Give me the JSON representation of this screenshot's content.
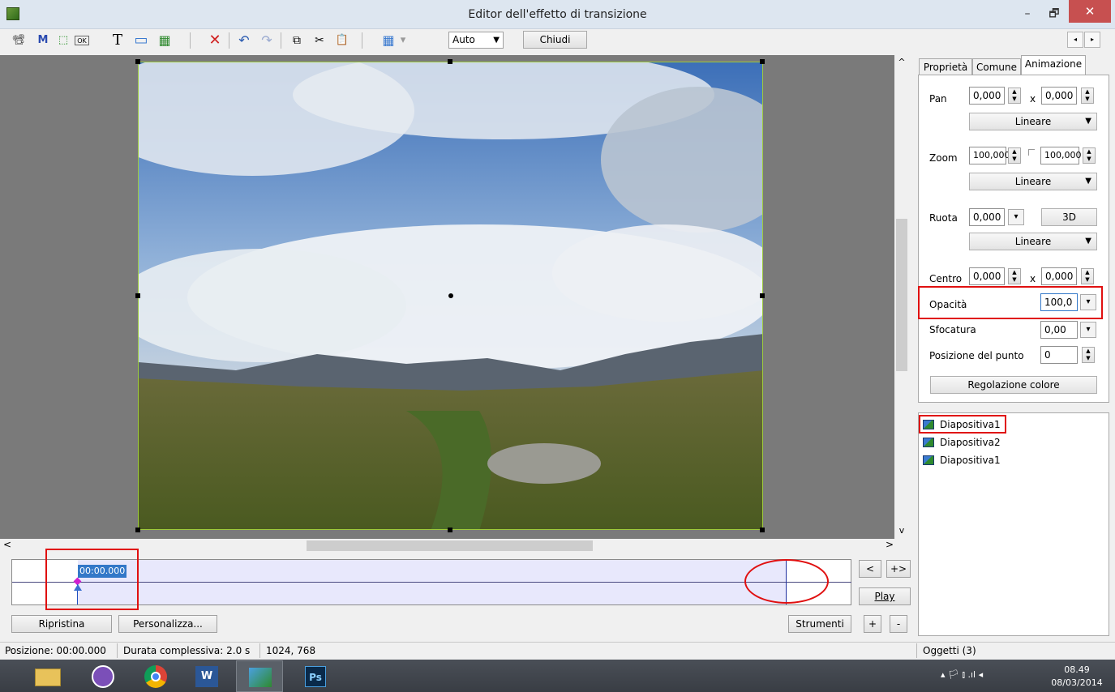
{
  "window": {
    "title": "Editor dell'effetto di transizione",
    "minimize": "–",
    "maximize": "🗗",
    "close": "✕"
  },
  "toolbar": {
    "auto_label": "Auto",
    "close_label": "Chiudi",
    "icons": {
      "camera": "📽",
      "mask": "M",
      "frame": "⬚",
      "button": "OK",
      "text": "T",
      "rect": "▭",
      "image": "▦",
      "delete": "✕",
      "undo": "↶",
      "redo": "↷",
      "copy": "⧉",
      "cut": "✂",
      "paste": "📋",
      "grid": "▦",
      "grid_arrow": "▾"
    },
    "nav_left": "◂",
    "nav_right": "▸"
  },
  "scroll": {
    "up": "^",
    "down": "v",
    "left": "<",
    "right": ">"
  },
  "timeline": {
    "time": "00:00.000"
  },
  "controls": {
    "ripristina": "Ripristina",
    "personalizza": "Personalizza...",
    "strumenti": "Strumenti",
    "prev": "<",
    "next": "+>",
    "play": "Play",
    "plus": "+",
    "minus": "-"
  },
  "panel": {
    "tabs": [
      "Proprietà",
      "Comune",
      "Animazione"
    ],
    "pan": {
      "label": "Pan",
      "x": "0,000",
      "sep": "x",
      "y": "0,000",
      "curve": "Lineare"
    },
    "zoom": {
      "label": "Zoom",
      "x": "100,000",
      "y": "100,000",
      "curve": "Lineare"
    },
    "rotate": {
      "label": "Ruota",
      "value": "0,000",
      "btn3d": "3D",
      "curve": "Lineare"
    },
    "center": {
      "label": "Centro",
      "x": "0,000",
      "sep": "x",
      "y": "0,000"
    },
    "opacity": {
      "label": "Opacità",
      "value": "100,0"
    },
    "blur": {
      "label": "Sfocatura",
      "value": "0,00"
    },
    "point_pos": {
      "label": "Posizione del punto",
      "value": "0"
    },
    "color_btn": "Regolazione colore"
  },
  "objects": [
    "Diapositiva1",
    "Diapositiva2",
    "Diapositiva1"
  ],
  "status": {
    "position": "Posizione: 00:00.000",
    "duration": "Durata complessiva: 2.0 s",
    "resolution": "1024, 768",
    "objects": "Oggetti (3)"
  },
  "taskbar": {
    "time": "08.49",
    "date": "08/03/2014",
    "tray": "▴  🏳  ⫾  .ıl  ◂"
  },
  "colors": {
    "accent": "#3378c8",
    "highlight": "#e01010",
    "timeline_bg": "#e8e8fc"
  }
}
